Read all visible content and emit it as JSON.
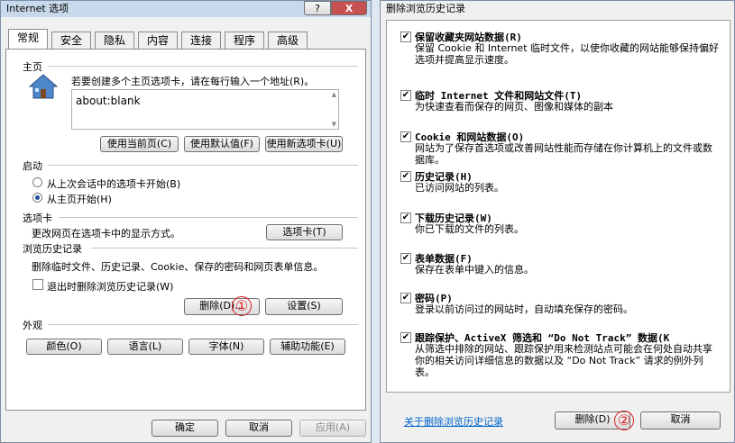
{
  "left_window": {
    "title": "Internet 选项",
    "help_btn": "?",
    "close_btn": "X",
    "tabs": [
      "常规",
      "安全",
      "隐私",
      "内容",
      "连接",
      "程序",
      "高级"
    ],
    "homepage": {
      "section": "主页",
      "hint": "若要创建多个主页选项卡，请在每行输入一个地址(R)。",
      "url": "about:blank",
      "use_current": "使用当前页(C)",
      "use_default": "使用默认值(F)",
      "use_new_tab": "使用新选项卡(U)"
    },
    "startup": {
      "section": "启动",
      "opt1": "从上次会话中的选项卡开始(B)",
      "opt2": "从主页开始(H)"
    },
    "tabs_section": {
      "section": "选项卡",
      "desc": "更改网页在选项卡中的显示方式。",
      "button": "选项卡(T)"
    },
    "history": {
      "section": "浏览历史记录",
      "desc": "删除临时文件、历史记录、Cookie、保存的密码和网页表单信息。",
      "checkbox": "退出时删除浏览历史记录(W)",
      "delete": "删除(D)...",
      "settings": "设置(S)",
      "marker": "①"
    },
    "appearance": {
      "section": "外观",
      "colors": "颜色(O)",
      "languages": "语言(L)",
      "fonts": "字体(N)",
      "accessibility": "辅助功能(E)"
    },
    "ok": "确定",
    "cancel": "取消",
    "apply": "应用(A)"
  },
  "right_window": {
    "title": "删除浏览历史记录",
    "items": [
      {
        "title": "保留收藏夹网站数据(R)",
        "desc": "保留 Cookie 和 Internet 临时文件，以使你收藏的网站能够保持偏好选项并提高显示速度。"
      },
      {
        "title": "临时 Internet 文件和网站文件(T)",
        "desc": "为快速查看而保存的网页、图像和媒体的副本"
      },
      {
        "title": "Cookie 和网站数据(O)",
        "desc": "网站为了保存首选项或改善网站性能而存储在你计算机上的文件或数据库。"
      },
      {
        "title": "历史记录(H)",
        "desc": "已访问网站的列表。"
      },
      {
        "title": "下载历史记录(W)",
        "desc": "你已下载的文件的列表。"
      },
      {
        "title": "表单数据(F)",
        "desc": "保存在表单中键入的信息。"
      },
      {
        "title": "密码(P)",
        "desc": "登录以前访问过的网站时，自动填充保存的密码。"
      },
      {
        "title": "跟踪保护、ActiveX 筛选和 “Do Not Track” 数据(K",
        "desc": "从筛选中排除的网站、跟踪保护用来检测站点可能会在何处自动共享你的相关访问详细信息的数据以及 “Do Not Track” 请求的例外列表。"
      }
    ],
    "link": "关于删除浏览历史记录",
    "delete": "删除(D)",
    "cancel": "取消",
    "marker": "②",
    "link_color": "#0066cc"
  }
}
